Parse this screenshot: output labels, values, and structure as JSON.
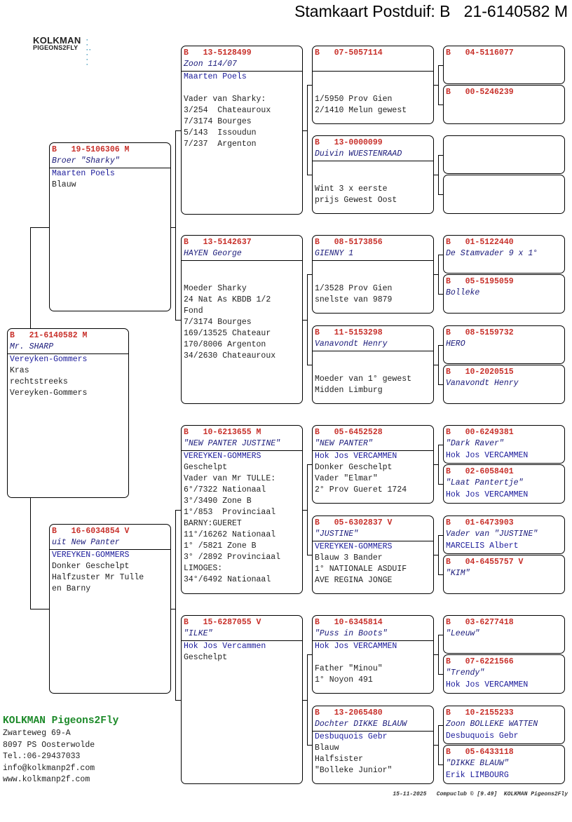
{
  "title": "Stamkaart Postduif: B   21-6140582 M",
  "logo": {
    "line1": "KOLKMAN",
    "line2": "PIGEONS2FLY"
  },
  "colors": {
    "ring": "#c8302a",
    "name": "#1a1a7a",
    "brand": "#1d8a2a"
  },
  "pigeons": [
    {
      "prefix": "B",
      "ring": "21-6140582",
      "sex": "M",
      "name": "Mr. SHARP",
      "owner": "Vereyken-Gommers",
      "lines": [
        "Kras",
        "rechtstreeks",
        "Vereyken-Gommers"
      ]
    },
    {
      "prefix": "B",
      "ring": "19-5106306",
      "sex": "M",
      "name": "Broer \"Sharky\"",
      "owner": "Maarten Poels",
      "lines": [
        "Blauw"
      ]
    },
    {
      "prefix": "B",
      "ring": "16-6034854",
      "sex": "V",
      "name": "uit New Panter",
      "owner": "VEREYKEN-GOMMERS",
      "lines": [
        "Donker Geschelpt",
        "Halfzuster Mr Tulle",
        "en Barny"
      ]
    },
    {
      "prefix": "B",
      "ring": "13-5128499",
      "sex": "",
      "name": "Zoon 114/07",
      "owner": "Maarten Poels",
      "lines": [
        "",
        "Vader van Sharky:",
        "3/254  Chateauroux",
        "7/3174 Bourges",
        "5/143  Issoudun",
        "7/237  Argenton"
      ]
    },
    {
      "prefix": "B",
      "ring": "13-5142637",
      "sex": "",
      "name": "HAYEN George",
      "owner": "",
      "lines": [
        "",
        "Moeder Sharky",
        "24 Nat As KBDB 1/2",
        "Fond",
        "7/3174 Bourges",
        "169/13525 Chateaur",
        "170/8006 Argenton",
        "34/2630 Chateauroux"
      ]
    },
    {
      "prefix": "B",
      "ring": "10-6213655",
      "sex": "M",
      "name": "\"NEW PANTER JUSTINE\"",
      "owner": "VEREYKEN-GOMMERS",
      "lines": [
        "Geschelpt",
        "Vader van Mr TULLE:",
        "6°/7322 Nationaal",
        "3°/3490 Zone B",
        "1°/853  Provinciaal",
        "BARNY:GUERET",
        "11°/16262 Nationaal",
        "1° /5821 Zone B",
        "3° /2892 Provinciaal",
        "LIMOGES:",
        "34°/6492 Nationaal"
      ]
    },
    {
      "prefix": "B",
      "ring": "15-6287055",
      "sex": "V",
      "name": "\"ILKE\"",
      "owner": "Hok Jos Vercammen",
      "lines": [
        "Geschelpt"
      ]
    },
    {
      "prefix": "B",
      "ring": "07-5057114",
      "sex": "",
      "name": "",
      "owner": "",
      "lines": [
        "",
        "1/5950 Prov Gien",
        "2/1410 Melun gewest"
      ]
    },
    {
      "prefix": "B",
      "ring": "13-0000099",
      "sex": "",
      "name": "Duivin WUESTENRAAD",
      "owner": "",
      "lines": [
        "",
        "Wint 3 x eerste",
        "prijs Gewest Oost"
      ]
    },
    {
      "prefix": "B",
      "ring": "08-5173856",
      "sex": "",
      "name": "GIENNY 1",
      "owner": "",
      "lines": [
        "",
        "1/3528 Prov Gien",
        "snelste van 9879"
      ]
    },
    {
      "prefix": "B",
      "ring": "11-5153298",
      "sex": "",
      "name": "Vanavondt Henry",
      "owner": "",
      "lines": [
        "",
        "Moeder van 1° gewest",
        "Midden Limburg"
      ]
    },
    {
      "prefix": "B",
      "ring": "05-6452528",
      "sex": "",
      "name": "\"NEW PANTER\"",
      "owner": "Hok Jos VERCAMMEN",
      "lines": [
        "Donker Geschelpt",
        "Vader \"Elmar\"",
        "2° Prov Gueret 1724"
      ]
    },
    {
      "prefix": "B",
      "ring": "05-6302837",
      "sex": "V",
      "name": "\"JUSTINE\"",
      "owner": "VEREYKEN-GOMMERS",
      "lines": [
        "Blauw 3 Bander",
        "1° NATIONALE ASDUIF",
        "AVE REGINA JONGE"
      ]
    },
    {
      "prefix": "B",
      "ring": "10-6345814",
      "sex": "",
      "name": "\"Puss in Boots\"",
      "owner": "Hok Jos VERCAMMEN",
      "lines": [
        "",
        "Father \"Minou\"",
        "1° Noyon 491"
      ]
    },
    {
      "prefix": "B",
      "ring": "13-2065480",
      "sex": "",
      "name": "Dochter DIKKE BLAUW",
      "owner": "Desbuquois Gebr",
      "lines": [
        "Blauw",
        "Halfsister",
        "\"Bolleke Junior\""
      ]
    },
    {
      "prefix": "B",
      "ring": "04-5116077",
      "sex": "",
      "name": "",
      "owner": ""
    },
    {
      "prefix": "B",
      "ring": "00-5246239",
      "sex": "",
      "name": "",
      "owner": ""
    },
    {},
    {},
    {
      "prefix": "B",
      "ring": "01-5122440",
      "sex": "",
      "name": "De Stamvader 9 x 1°",
      "owner": ""
    },
    {
      "prefix": "B",
      "ring": "05-5195059",
      "sex": "",
      "name": "Bolleke",
      "owner": ""
    },
    {
      "prefix": "B",
      "ring": "08-5159732",
      "sex": "",
      "name": "HERO",
      "owner": ""
    },
    {
      "prefix": "B",
      "ring": "10-2020515",
      "sex": "",
      "name": "Vanavondt Henry",
      "owner": ""
    },
    {
      "prefix": "B",
      "ring": "00-6249381",
      "sex": "",
      "name": "\"Dark Raver\"",
      "owner": "Hok Jos VERCAMMEN"
    },
    {
      "prefix": "B",
      "ring": "02-6058401",
      "sex": "",
      "name": "\"Laat Pantertje\"",
      "owner": "Hok Jos VERCAMMEN"
    },
    {
      "prefix": "B",
      "ring": "01-6473903",
      "sex": "",
      "name": "Vader van \"JUSTINE\"",
      "owner": "MARCELIS Albert"
    },
    {
      "prefix": "B",
      "ring": "04-6455757",
      "sex": "V",
      "name": "\"KIM\"",
      "owner": ""
    },
    {
      "prefix": "B",
      "ring": "03-6277418",
      "sex": "",
      "name": "\"Leeuw\"",
      "owner": ""
    },
    {
      "prefix": "B",
      "ring": "07-6221566",
      "sex": "",
      "name": "\"Trendy\"",
      "owner": "Hok Jos VERCAMMEN"
    },
    {
      "prefix": "B",
      "ring": "10-2155233",
      "sex": "",
      "name": "Zoon BOLLEKE WATTEN",
      "owner": "Desbuquois Gebr"
    },
    {
      "prefix": "B",
      "ring": "05-6433118",
      "sex": "",
      "name": "\"DIKKE BLAUW\"",
      "owner": "Erik LIMBOURG"
    }
  ],
  "address": {
    "brand": "KOLKMAN Pigeons2Fly",
    "lines": [
      "Zwarteweg 69-A",
      "8097 PS  Oosterwolde",
      "Tel.:06-29437033",
      "info@kolkmanp2f.com",
      "www.kolkmanp2f.com"
    ]
  },
  "footer": "15-11-2025   Compuclub © [9.49]  KOLKMAN Pigeons2Fly"
}
